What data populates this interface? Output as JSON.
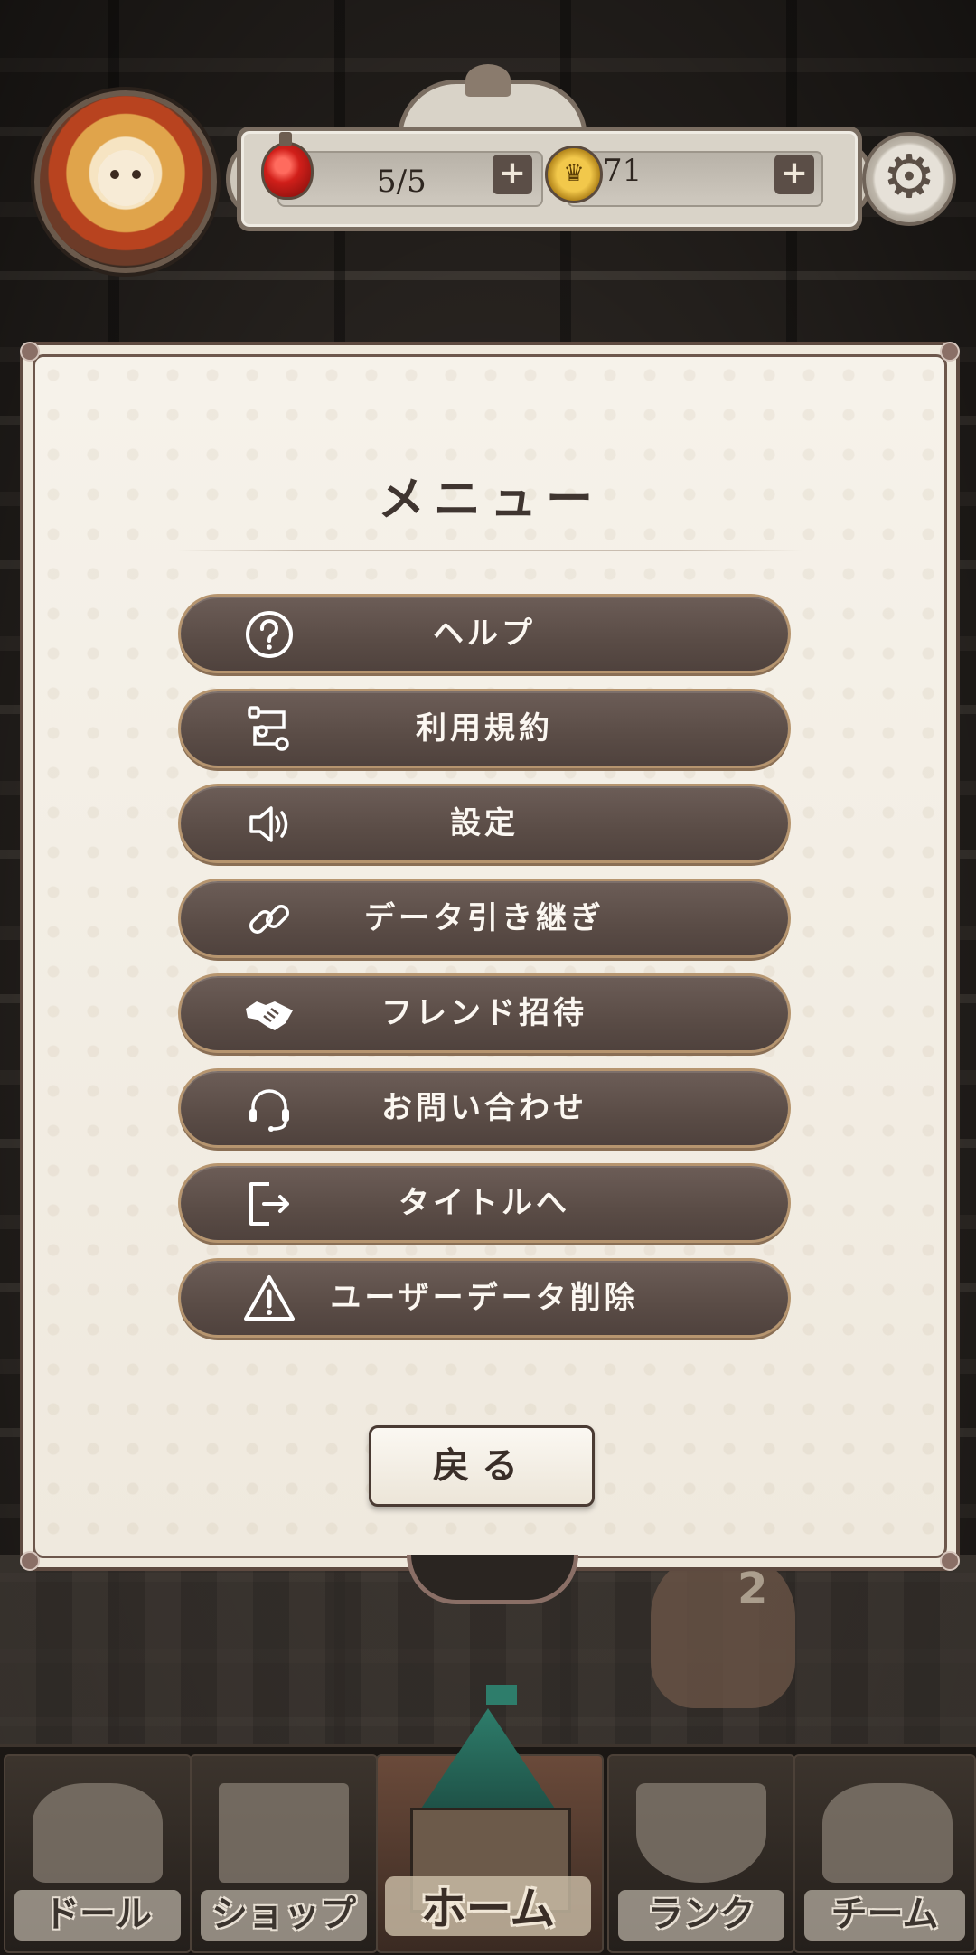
{
  "hud": {
    "stamina": "5/5",
    "coins": "71",
    "plus_symbol": "+"
  },
  "menu": {
    "title": "メニュー",
    "items": [
      {
        "label": "ヘルプ",
        "icon": "help-circle-icon"
      },
      {
        "label": "利用規約",
        "icon": "flow-icon"
      },
      {
        "label": "設定",
        "icon": "speaker-icon"
      },
      {
        "label": "データ引き継ぎ",
        "icon": "link-icon"
      },
      {
        "label": "フレンド招待",
        "icon": "handshake-icon"
      },
      {
        "label": "お問い合わせ",
        "icon": "headset-icon"
      },
      {
        "label": "タイトルへ",
        "icon": "exit-icon"
      },
      {
        "label": "ユーザーデータ削除",
        "icon": "warning-icon"
      }
    ],
    "back_label": "戻る"
  },
  "nav": {
    "items": [
      {
        "label": "ドール"
      },
      {
        "label": "ショップ"
      },
      {
        "label": "ホーム"
      },
      {
        "label": "ランク"
      },
      {
        "label": "チーム"
      }
    ]
  },
  "background": {
    "balloon_number": "2"
  }
}
